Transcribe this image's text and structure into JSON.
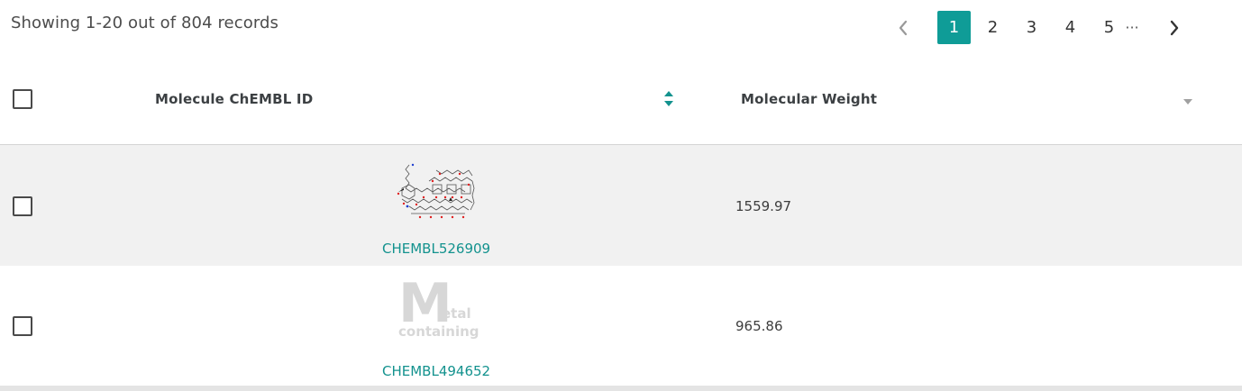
{
  "summary": {
    "text": "Showing 1-20 out of 804 records"
  },
  "pagination": {
    "pages": [
      "1",
      "2",
      "3",
      "4",
      "5"
    ],
    "current": "1",
    "ellipsis": "···",
    "accent_color": "#0f9c97"
  },
  "table": {
    "columns": [
      {
        "label": "Molecule ChEMBL ID",
        "sort_icon": "sort-updown-icon"
      },
      {
        "label": "Molecular Weight",
        "sort_icon": "caret-down-icon"
      }
    ],
    "rows": [
      {
        "chembl_id": "CHEMBL526909",
        "molecular_weight": "1559.97",
        "image": "structure-drawing"
      },
      {
        "chembl_id": "CHEMBL494652",
        "molecular_weight": "965.86",
        "image": "metal-containing-placeholder",
        "placeholder_big": "M",
        "placeholder_small": "etal",
        "placeholder_bottom": "containing"
      }
    ]
  },
  "link_color": "#13928e"
}
